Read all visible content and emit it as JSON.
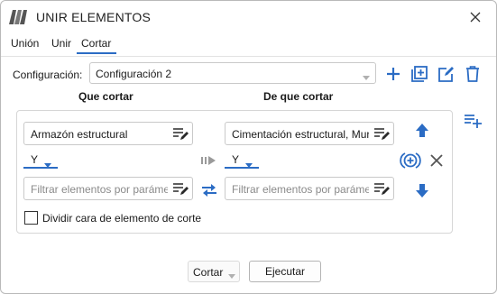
{
  "window": {
    "title": "UNIR ELEMENTOS"
  },
  "tabs": [
    {
      "label": "Unión"
    },
    {
      "label": "Unir"
    },
    {
      "label": "Cortar",
      "active": true
    }
  ],
  "config": {
    "label": "Configuración:",
    "selected": "Configuración 2",
    "actions": [
      "add-icon",
      "duplicate-icon",
      "edit-icon",
      "delete-icon"
    ]
  },
  "columns": {
    "left_header": "Que cortar",
    "right_header": "De que cortar"
  },
  "rule": {
    "left_filter1": "Armazón estructural",
    "left_operator": "Y",
    "left_filter2_placeholder": "Filtrar elementos por parámetro",
    "right_filter1": "Cimentación estructural, Muros",
    "right_operator": "Y",
    "right_filter2_placeholder": "Filtrar elementos por parámetro",
    "split_face_label": "Dividir cara de elemento de corte",
    "split_face_checked": false
  },
  "footer": {
    "mode": "Cortar",
    "execute_label": "Ejecutar"
  },
  "colors": {
    "accent": "#2b6cc4",
    "icon_gray": "#3a3a3a",
    "disabled": "#9a9a9a"
  }
}
